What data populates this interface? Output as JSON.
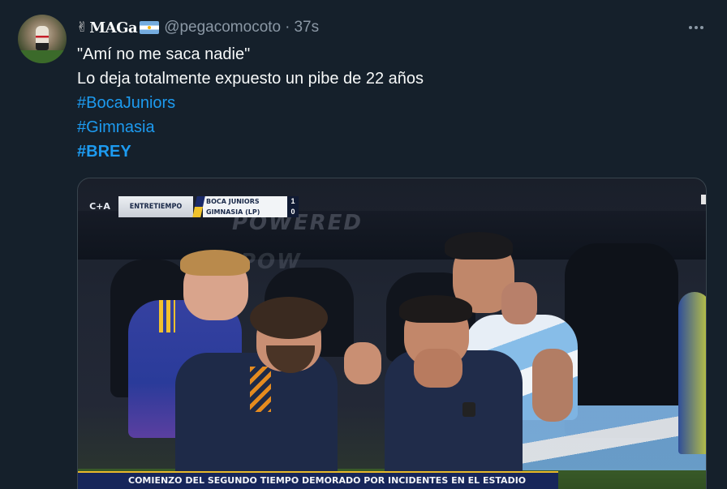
{
  "tweet": {
    "display_name": "MAGa",
    "name_prefix_icon": "wing-icon",
    "name_suffix_icon": "argentina-flag-icon",
    "handle": "@pegacomocoto",
    "separator": "·",
    "time": "37s",
    "more_icon": "more-options-icon",
    "lines": [
      "\"Amí no me saca nadie\"",
      "Lo deja totalmente expuesto un pibe de 22 años"
    ],
    "hashtags": [
      "#BocaJuniors",
      "#Gimnasia",
      "#BREY"
    ],
    "colors": {
      "background": "#15202b",
      "text": "#f7f9f9",
      "muted": "#8b98a5",
      "link": "#1d9bf0"
    }
  },
  "media": {
    "scoreboard": {
      "logo": "C+A",
      "period": "ENTRETIEMPO",
      "team_home": "BOCA JUNIORS",
      "team_away": "GIMNASIA (LP)",
      "score_home": "1",
      "score_away": "0"
    },
    "ticker": "COMIENZO DEL SEGUNDO TIEMPO DEMORADO POR INCIDENTES EN EL ESTADIO",
    "banner_text": "POWERED",
    "banner_text_2": "POW"
  }
}
